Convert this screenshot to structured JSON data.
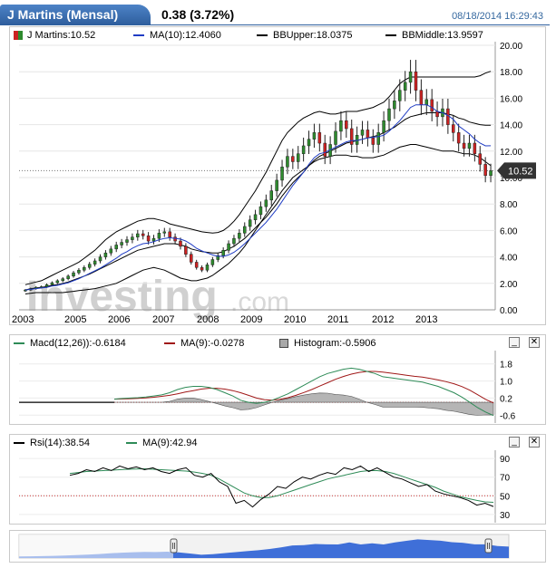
{
  "header": {
    "title": "J Martins (Mensal)",
    "price": "0.38 (3.72%)",
    "datetime": "08/18/2014 16:29:43"
  },
  "watermark": {
    "brand": "Investing",
    "suffix": ".com"
  },
  "main_legend": {
    "price_label": "J Martins:10.52",
    "ma_label": "MA(10):12.4060",
    "bbupper_label": "BBUpper:18.0375",
    "bbmiddle_label": "BBMiddle:13.9597"
  },
  "price_tag": "10.52",
  "macd_legend": {
    "macd_label": "Macd(12,26)):-0.6184",
    "ma_label": "MA(9):-0.0278",
    "hist_label": "Histogram:-0.5906"
  },
  "rsi_legend": {
    "rsi_label": "Rsi(14):38.54",
    "ma_label": "MA(9):42.94"
  },
  "controls": {
    "minimize": "_",
    "close": "✕"
  },
  "colors": {
    "up": "#2e8b2e",
    "down": "#cc2222",
    "ma": "#1f3cc4",
    "ma_lower": "#2e8b57",
    "signal": "#a01818",
    "navigator": "#3f6fd8"
  },
  "chart_data": [
    {
      "type": "candlestick",
      "title": "J Martins (Mensal)",
      "x_ticks": [
        "2003",
        "2005",
        "2006",
        "2007",
        "2008",
        "2009",
        "2010",
        "2011",
        "2012",
        "2013"
      ],
      "y_ticks": [
        "20.00",
        "18.00",
        "16.00",
        "14.00",
        "12.00",
        "10.00",
        "8.00",
        "6.00",
        "4.00",
        "2.00",
        "0.00"
      ],
      "ylim": [
        0,
        20
      ],
      "last": 10.52,
      "close": [
        1.5,
        1.6,
        1.7,
        1.75,
        1.9,
        2.05,
        2.2,
        2.35,
        2.55,
        2.8,
        3.0,
        3.2,
        3.45,
        3.7,
        4.0,
        4.3,
        4.6,
        4.9,
        5.1,
        5.3,
        5.5,
        5.75,
        5.6,
        5.2,
        5.4,
        5.8,
        5.9,
        5.5,
        5.2,
        4.8,
        4.2,
        3.6,
        3.2,
        3.0,
        3.4,
        3.8,
        4.1,
        4.5,
        5.0,
        5.4,
        5.8,
        6.3,
        6.8,
        7.2,
        7.8,
        8.3,
        9.0,
        9.8,
        10.8,
        11.6,
        11.2,
        11.8,
        12.4,
        12.9,
        13.4,
        12.6,
        11.6,
        12.5,
        13.5,
        14.3,
        13.7,
        12.5,
        13.2,
        13.6,
        13.0,
        12.5,
        13.4,
        14.3,
        15.2,
        15.8,
        16.6,
        17.2,
        18.0,
        16.6,
        15.5,
        15.9,
        15.0,
        14.6,
        15.2,
        14.0,
        13.4,
        12.6,
        12.2,
        12.6,
        11.8,
        11.0,
        10.15,
        10.52
      ],
      "ma10": [
        1.5,
        1.55,
        1.6,
        1.65,
        1.7,
        1.8,
        1.85,
        1.95,
        2.05,
        2.2,
        2.35,
        2.55,
        2.75,
        2.95,
        3.15,
        3.4,
        3.65,
        3.9,
        4.2,
        4.4,
        4.65,
        4.85,
        5.0,
        5.05,
        5.15,
        5.3,
        5.4,
        5.45,
        5.4,
        5.35,
        5.2,
        4.95,
        4.65,
        4.45,
        4.3,
        4.15,
        4.05,
        4.05,
        4.15,
        4.35,
        4.65,
        5.0,
        5.4,
        5.8,
        6.2,
        6.6,
        7.1,
        7.6,
        8.2,
        8.8,
        9.4,
        9.9,
        10.4,
        11.0,
        11.5,
        11.8,
        11.9,
        12.1,
        12.3,
        12.5,
        12.7,
        12.8,
        12.8,
        12.9,
        13.0,
        13.05,
        13.1,
        13.2,
        13.5,
        13.9,
        14.3,
        14.8,
        15.3,
        15.5,
        15.5,
        15.5,
        15.3,
        15.0,
        14.9,
        14.7,
        14.4,
        13.9,
        13.6,
        13.3,
        12.9,
        12.6,
        12.4,
        12.406
      ],
      "bb_upper": [
        1.9,
        2.0,
        2.1,
        2.2,
        2.4,
        2.6,
        2.8,
        3.0,
        3.2,
        3.4,
        3.6,
        3.9,
        4.2,
        4.5,
        4.9,
        5.3,
        5.6,
        5.9,
        6.1,
        6.3,
        6.5,
        6.7,
        6.8,
        6.9,
        6.9,
        6.8,
        6.7,
        6.5,
        6.4,
        6.3,
        6.2,
        6.1,
        6.0,
        5.9,
        5.85,
        5.8,
        5.85,
        6.0,
        6.3,
        6.7,
        7.2,
        7.8,
        8.4,
        9.0,
        9.7,
        10.4,
        11.2,
        12.0,
        12.8,
        13.4,
        13.8,
        14.2,
        14.5,
        14.7,
        14.9,
        15.0,
        14.9,
        14.8,
        14.8,
        14.9,
        15.0,
        15.0,
        15.0,
        15.1,
        15.2,
        15.3,
        15.5,
        15.7,
        16.1,
        16.6,
        17.1,
        17.4,
        17.6,
        17.6,
        17.6,
        17.6,
        17.6,
        17.6,
        17.6,
        17.6,
        17.6,
        17.6,
        17.6,
        17.6,
        17.6,
        17.7,
        17.9,
        18.0375
      ],
      "bb_middle": [
        1.5,
        1.6,
        1.65,
        1.7,
        1.75,
        1.85,
        1.9,
        2.0,
        2.1,
        2.25,
        2.4,
        2.55,
        2.7,
        2.9,
        3.1,
        3.3,
        3.5,
        3.7,
        3.9,
        4.1,
        4.3,
        4.5,
        4.6,
        4.7,
        4.8,
        4.9,
        5.0,
        5.0,
        5.0,
        4.9,
        4.8,
        4.6,
        4.5,
        4.4,
        4.35,
        4.3,
        4.3,
        4.4,
        4.6,
        4.8,
        5.1,
        5.4,
        5.8,
        6.2,
        6.6,
        7.0,
        7.5,
        8.0,
        8.6,
        9.1,
        9.6,
        10.0,
        10.4,
        10.9,
        11.3,
        11.6,
        11.8,
        12.0,
        12.2,
        12.4,
        12.6,
        12.7,
        12.8,
        12.9,
        13.0,
        13.1,
        13.2,
        13.4,
        13.6,
        13.8,
        14.1,
        14.4,
        14.6,
        14.7,
        14.8,
        14.9,
        14.9,
        14.9,
        14.9,
        14.8,
        14.7,
        14.5,
        14.4,
        14.2,
        14.1,
        14.0,
        13.96,
        13.9597
      ],
      "bb_lower": [
        1.2,
        1.25,
        1.3,
        1.3,
        1.3,
        1.3,
        1.3,
        1.3,
        1.35,
        1.4,
        1.45,
        1.5,
        1.55,
        1.6,
        1.7,
        1.8,
        1.9,
        2.0,
        2.2,
        2.4,
        2.6,
        2.8,
        3.0,
        3.1,
        3.2,
        3.1,
        3.0,
        2.8,
        2.6,
        2.4,
        2.3,
        2.2,
        2.2,
        2.3,
        2.4,
        2.6,
        2.9,
        3.2,
        3.5,
        3.9,
        4.3,
        4.8,
        5.4,
        6.0,
        6.6,
        7.2,
        7.8,
        8.4,
        9.0,
        9.5,
        10.0,
        10.3,
        10.6,
        10.9,
        11.2,
        11.4,
        11.5,
        11.6,
        11.7,
        11.7,
        11.7,
        11.6,
        11.6,
        11.5,
        11.5,
        11.5,
        11.6,
        11.7,
        11.9,
        12.1,
        12.3,
        12.4,
        12.5,
        12.5,
        12.4,
        12.3,
        12.2,
        12.1,
        12.0,
        12.0,
        12.0,
        11.9,
        11.8,
        11.8,
        11.7,
        11.5,
        11.2,
        10.9
      ]
    },
    {
      "type": "line",
      "title": "MACD",
      "y_ticks": [
        "1.8",
        "1.0",
        "0.2",
        "-0.6"
      ],
      "ylim": [
        -0.8,
        2.0
      ],
      "macd": [
        0.15,
        0.18,
        0.2,
        0.22,
        0.25,
        0.3,
        0.35,
        0.45,
        0.6,
        0.7,
        0.75,
        0.75,
        0.7,
        0.6,
        0.45,
        0.3,
        0.1,
        0.0,
        -0.05,
        0.0,
        0.1,
        0.25,
        0.4,
        0.6,
        0.8,
        1.0,
        1.2,
        1.35,
        1.45,
        1.55,
        1.6,
        1.55,
        1.45,
        1.35,
        1.2,
        1.15,
        1.1,
        1.05,
        1.0,
        0.95,
        0.85,
        0.75,
        0.6,
        0.45,
        0.25,
        0.0,
        -0.25,
        -0.45,
        -0.6184
      ],
      "signal": [
        0.15,
        0.16,
        0.17,
        0.19,
        0.21,
        0.24,
        0.28,
        0.33,
        0.4,
        0.48,
        0.55,
        0.62,
        0.66,
        0.66,
        0.62,
        0.55,
        0.45,
        0.33,
        0.2,
        0.12,
        0.1,
        0.14,
        0.22,
        0.33,
        0.46,
        0.6,
        0.76,
        0.92,
        1.08,
        1.21,
        1.32,
        1.4,
        1.45,
        1.45,
        1.42,
        1.37,
        1.32,
        1.27,
        1.22,
        1.18,
        1.12,
        1.05,
        0.97,
        0.87,
        0.74,
        0.57,
        0.36,
        0.14,
        -0.0278
      ],
      "histogram": [
        0,
        0,
        0,
        0,
        0,
        0,
        0,
        0.05,
        0.15,
        0.2,
        0.2,
        0.13,
        0.04,
        -0.06,
        -0.17,
        -0.25,
        -0.35,
        -0.33,
        -0.25,
        -0.12,
        0,
        0.1,
        0.18,
        0.27,
        0.34,
        0.4,
        0.44,
        0.43,
        0.37,
        0.34,
        0.28,
        0.15,
        0,
        -0.1,
        -0.22,
        -0.22,
        -0.22,
        -0.22,
        -0.22,
        -0.23,
        -0.27,
        -0.3,
        -0.37,
        -0.42,
        -0.49,
        -0.57,
        -0.61,
        -0.59,
        -0.5906
      ]
    },
    {
      "type": "line",
      "title": "RSI",
      "y_ticks": [
        "90",
        "70",
        "50",
        "30"
      ],
      "ylim": [
        25,
        95
      ],
      "rsi": [
        72,
        74,
        78,
        76,
        80,
        77,
        82,
        79,
        81,
        78,
        80,
        76,
        74,
        78,
        80,
        72,
        70,
        74,
        65,
        60,
        42,
        45,
        38,
        46,
        52,
        60,
        58,
        65,
        70,
        68,
        72,
        75,
        73,
        80,
        78,
        82,
        76,
        80,
        75,
        70,
        68,
        64,
        60,
        62,
        55,
        52,
        50,
        48,
        45,
        40,
        42,
        38.54
      ],
      "ma9": [
        74,
        75,
        76,
        76.5,
        77,
        77.5,
        78,
        78.5,
        78.8,
        79,
        78.5,
        78,
        77.5,
        77,
        76.5,
        75.5,
        74,
        72,
        68,
        63,
        58,
        53,
        50,
        48,
        48,
        50,
        53,
        56,
        59,
        62,
        65,
        68,
        70,
        72,
        74,
        76,
        77,
        77,
        76,
        74,
        71,
        68,
        65,
        62,
        59,
        55,
        52,
        49,
        47,
        45,
        43.5,
        42.94
      ]
    }
  ],
  "navigator": {
    "values": [
      1.5,
      1.6,
      1.75,
      2.0,
      2.3,
      2.7,
      3.2,
      3.7,
      4.3,
      4.9,
      5.3,
      5.6,
      5.5,
      5.8,
      5.2,
      4.2,
      3.0,
      3.6,
      4.5,
      5.4,
      6.3,
      7.2,
      8.3,
      9.8,
      11.6,
      11.8,
      12.9,
      12.6,
      12.5,
      14.3,
      12.5,
      13.6,
      12.5,
      14.3,
      15.8,
      17.2,
      16.6,
      15.9,
      14.6,
      14.0,
      12.6,
      12.6,
      11.0,
      10.52
    ]
  }
}
